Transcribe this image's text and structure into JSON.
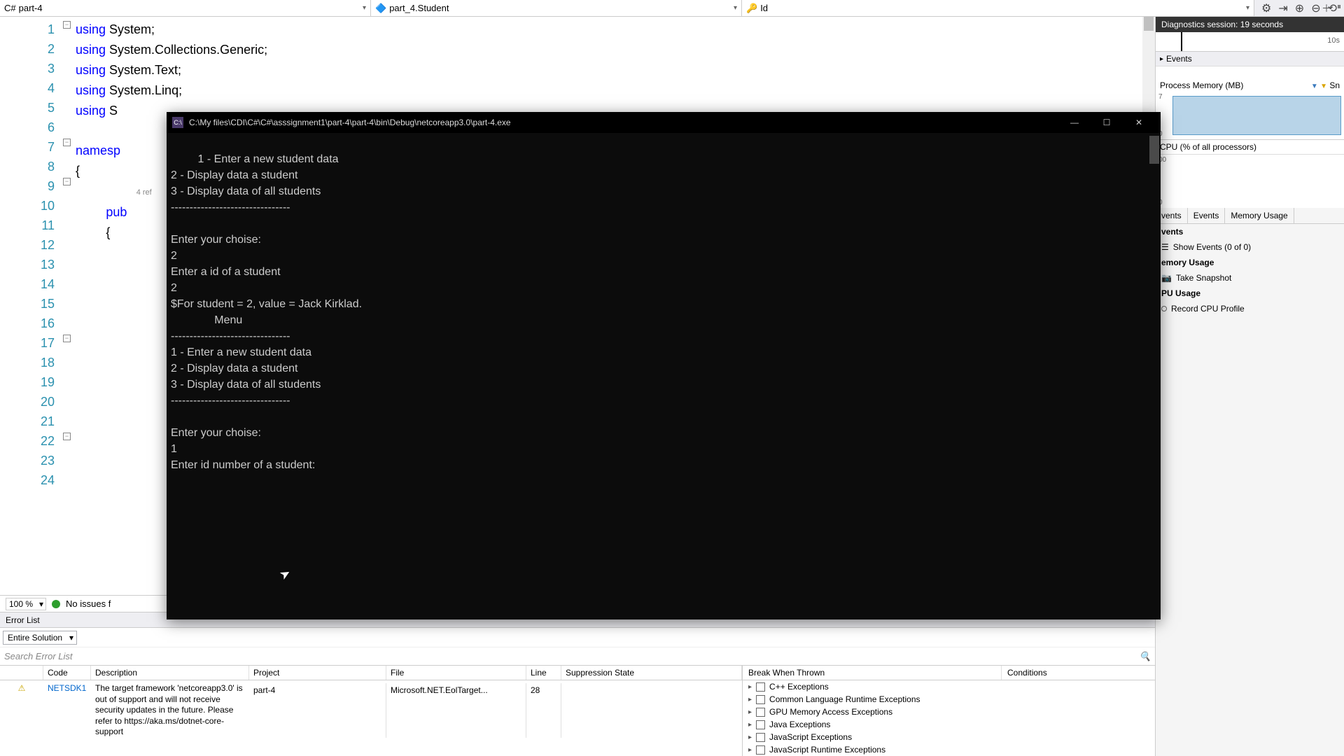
{
  "topbar": {
    "dropdown1": {
      "icon": "C#",
      "label": "part-4"
    },
    "dropdown2": {
      "icon": "🔷",
      "label": "part_4.Student"
    },
    "dropdown3": {
      "icon": "🔑",
      "label": "Id"
    }
  },
  "editor": {
    "lines": [
      "1",
      "2",
      "3",
      "4",
      "5",
      "6",
      "7",
      "8",
      "9",
      "10",
      "11",
      "12",
      "13",
      "14",
      "15",
      "16",
      "17",
      "18",
      "19",
      "20",
      "21",
      "22",
      "23",
      "24"
    ],
    "code_snippet_1": "using",
    "code_sys": " System;",
    "code_sys_coll": " System.Collections.Generic;",
    "code_sys_text": " System.Text;",
    "code_sys_linq": " System.Linq;",
    "code_using5": " S",
    "ns": "namesp",
    "brace": "{",
    "brace2": "{",
    "ref_lens": "4 ref",
    "pub": "pub",
    "zoom": "100 %",
    "status": "No issues f"
  },
  "console": {
    "title": "C:\\My files\\CDI\\C#\\C#\\asssignment1\\part-4\\part-4\\bin\\Debug\\netcoreapp3.0\\part-4.exe",
    "body": "1 - Enter a new student data\n2 - Display data a student\n3 - Display data of all students\n--------------------------------\n\nEnter your choise:\n2\nEnter a id of a student\n2\n$For student = 2, value = Jack Kirklad.\n              Menu\n--------------------------------\n1 - Enter a new student data\n2 - Display data a student\n3 - Display data of all students\n--------------------------------\n\nEnter your choise:\n1\nEnter id number of a student:"
  },
  "errorlist": {
    "title": "Error List",
    "scope": "Entire Solution",
    "search_placeholder": "Search Error List",
    "columns": {
      "code": "Code",
      "desc": "Description",
      "proj": "Project",
      "file": "File",
      "line": "Line",
      "supp": "Suppression State"
    },
    "row": {
      "code": "NETSDK1",
      "desc": "The target framework 'netcoreapp3.0' is out of support and will not receive security updates in the future. Please refer to https://aka.ms/dotnet-core-support",
      "proj": "part-4",
      "file": "Microsoft.NET.EolTarget...",
      "line": "28"
    }
  },
  "exceptions": {
    "col1": "Break When Thrown",
    "col2": "Conditions",
    "items": [
      "C++ Exceptions",
      "Common Language Runtime Exceptions",
      "GPU Memory Access Exceptions",
      "Java Exceptions",
      "JavaScript Exceptions",
      "JavaScript Runtime Exceptions"
    ]
  },
  "diagnostics": {
    "session": "Diagnostics session: 19 seconds",
    "time_label": "10s",
    "events_header": "Events",
    "proc_mem": "Process Memory (MB)",
    "mem_hi": "7",
    "mem_lo": "0",
    "cpu_label": "CPU (% of all processors)",
    "cpu_hi": "00",
    "cpu_lo": "0",
    "tabs": {
      "events": "vents",
      "events2": "Events",
      "memory": "Memory Usage"
    },
    "events_section": "vents",
    "show_events": "Show Events (0 of 0)",
    "mem_usage": "emory Usage",
    "take_snapshot": "Take Snapshot",
    "cpu_usage": "PU Usage",
    "record_cpu": "Record CPU Profile",
    "snap_short": "Sn"
  }
}
